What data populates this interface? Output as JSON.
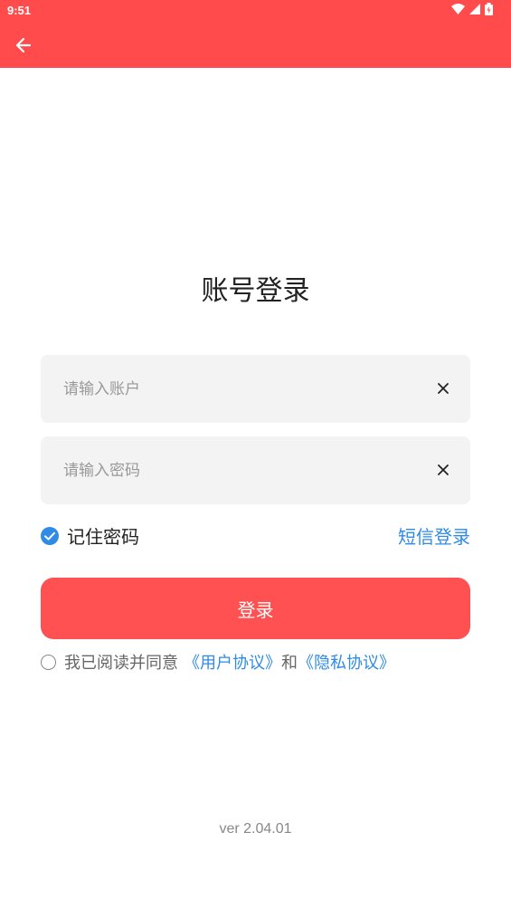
{
  "status_bar": {
    "time": "9:51"
  },
  "title": "账号登录",
  "account": {
    "placeholder": "请输入账户",
    "value": ""
  },
  "password": {
    "placeholder": "请输入密码",
    "value": ""
  },
  "remember": {
    "label": "记住密码",
    "checked": true
  },
  "sms_login": "短信登录",
  "login_button": "登录",
  "agreement": {
    "prefix": "我已阅读并同意",
    "user_agreement": "《用户协议》",
    "conjunction": "和",
    "privacy_policy": "《隐私协议》"
  },
  "version": "ver 2.04.01",
  "colors": {
    "header": "#FF4B4B",
    "button": "#FF5151",
    "link": "#2F8BE5",
    "field_bg": "#F3F3F3"
  }
}
